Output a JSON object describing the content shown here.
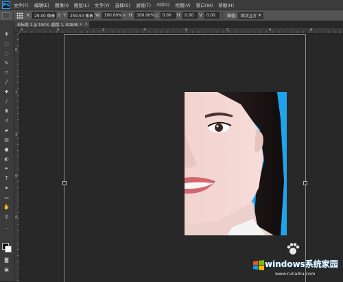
{
  "app": {
    "logo": "Ps"
  },
  "menu": [
    "文件(F)",
    "编辑(E)",
    "图像(I)",
    "图层(L)",
    "文字(Y)",
    "选择(S)",
    "滤镜(T)",
    "3D(D)",
    "视图(V)",
    "窗口(W)",
    "帮助(H)"
  ],
  "options": {
    "x_label": "X:",
    "x_value": "29.00 像素",
    "delta_label": "Δ",
    "y_label": "Y:",
    "y_value": "259.50 像素",
    "w_label": "W:",
    "w_value": "100.00%",
    "h_label": "H:",
    "h_value": "100.00%",
    "angle_value": "0.00",
    "hskew_label": "H:",
    "hskew_value": "0.00",
    "vskew_label": "V:",
    "vskew_value": "0.00",
    "interp_label": "插值:",
    "interp_value": "两次立方"
  },
  "document": {
    "tab_title": "未标题-1 @ 100% (图层 1, RGB/8) *",
    "close_glyph": "×"
  },
  "ruler": {
    "top": [
      "0",
      "2",
      "4",
      "6",
      "8",
      "10"
    ],
    "left": [
      "0",
      "2",
      "4",
      "6",
      "8"
    ]
  },
  "watermark": {
    "title": "windows系统家园",
    "url": "www.runaihu.com"
  },
  "colors": {
    "photo_background": "#1fa4ec",
    "canvas": "#282828",
    "panel": "#3b3b3b"
  }
}
